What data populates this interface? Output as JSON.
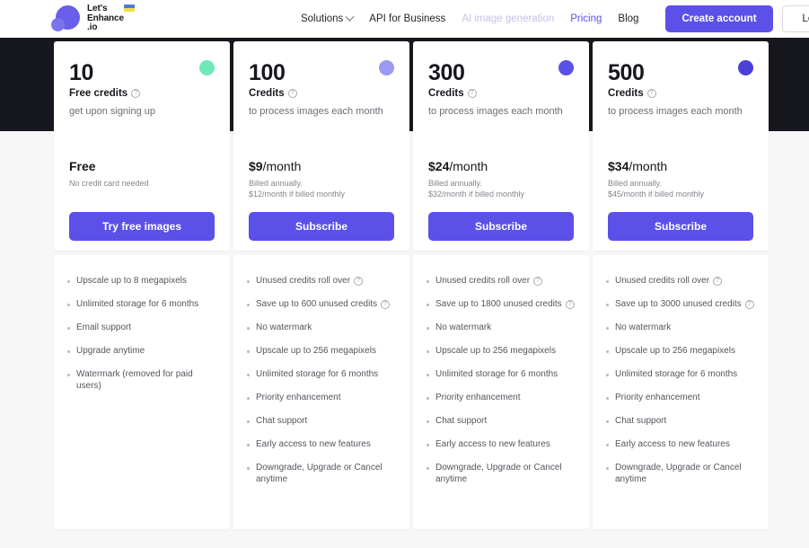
{
  "header": {
    "logo": {
      "line1": "Let's",
      "line2": "Enhance",
      "line3": ".io",
      "flag_name": "ukraine-flag"
    },
    "nav": [
      {
        "label": "Solutions",
        "style": "default",
        "has_chevron": true
      },
      {
        "label": "API for Business",
        "style": "default",
        "has_chevron": false
      },
      {
        "label": "AI image generation",
        "style": "muted",
        "has_chevron": false
      },
      {
        "label": "Pricing",
        "style": "accent",
        "has_chevron": false
      },
      {
        "label": "Blog",
        "style": "default",
        "has_chevron": false
      }
    ],
    "create_account_label": "Create account",
    "login_label": "Login"
  },
  "colors": {
    "accent": "#5b51e8",
    "dark_band": "#17181d",
    "badge_free": "#6fe8b8",
    "badge_100": "#9a9bf0",
    "badge_300": "#5a51e8",
    "badge_500": "#4b3fd6"
  },
  "plans": [
    {
      "credits_number": "10",
      "credits_label": "Free credits",
      "credits_has_info": true,
      "credits_sub": "get upon signing up",
      "badge_color": "#6fe8b8",
      "badge_name": "plan-badge-free",
      "price_main": "Free",
      "price_per": "",
      "price_note_line1": "No credit card needed",
      "price_note_line2": "",
      "cta_label": "Try free images",
      "features": [
        {
          "text": "Upscale up to 8 megapixels",
          "info": false
        },
        {
          "text": "Unlimited storage for 6 months",
          "info": false
        },
        {
          "text": "Email support",
          "info": false
        },
        {
          "text": "Upgrade anytime",
          "info": false
        },
        {
          "text": "Watermark (removed for paid users)",
          "info": false
        }
      ]
    },
    {
      "credits_number": "100",
      "credits_label": "Credits",
      "credits_has_info": true,
      "credits_sub": "to process images each month",
      "badge_color": "#9a9bf0",
      "badge_name": "plan-badge-100",
      "price_main": "$9",
      "price_per": "/month",
      "price_note_line1": "Billed annually.",
      "price_note_line2": "$12/month if billed monthly",
      "cta_label": "Subscribe",
      "features": [
        {
          "text": "Unused credits roll over",
          "info": true
        },
        {
          "text": "Save up to 600 unused credits",
          "info": true
        },
        {
          "text": "No watermark",
          "info": false
        },
        {
          "text": "Upscale up to 256 megapixels",
          "info": false
        },
        {
          "text": "Unlimited storage for 6 months",
          "info": false
        },
        {
          "text": "Priority enhancement",
          "info": false
        },
        {
          "text": "Chat support",
          "info": false
        },
        {
          "text": "Early access to new features",
          "info": false
        },
        {
          "text": "Downgrade, Upgrade or Cancel anytime",
          "info": false
        }
      ]
    },
    {
      "credits_number": "300",
      "credits_label": "Credits",
      "credits_has_info": true,
      "credits_sub": "to process images each month",
      "badge_color": "#5a51e8",
      "badge_name": "plan-badge-300",
      "price_main": "$24",
      "price_per": "/month",
      "price_note_line1": "Billed annually.",
      "price_note_line2": "$32/month if billed monthly",
      "cta_label": "Subscribe",
      "features": [
        {
          "text": "Unused credits roll over",
          "info": true
        },
        {
          "text": "Save up to 1800 unused credits",
          "info": true
        },
        {
          "text": "No watermark",
          "info": false
        },
        {
          "text": "Upscale up to 256 megapixels",
          "info": false
        },
        {
          "text": "Unlimited storage for 6 months",
          "info": false
        },
        {
          "text": "Priority enhancement",
          "info": false
        },
        {
          "text": "Chat support",
          "info": false
        },
        {
          "text": "Early access to new features",
          "info": false
        },
        {
          "text": "Downgrade, Upgrade or Cancel anytime",
          "info": false
        }
      ]
    },
    {
      "credits_number": "500",
      "credits_label": "Credits",
      "credits_has_info": true,
      "credits_sub": "to process images each month",
      "badge_color": "#4b3fd6",
      "badge_name": "plan-badge-500",
      "price_main": "$34",
      "price_per": "/month",
      "price_note_line1": "Billed annually.",
      "price_note_line2": "$45/month if billed monthly",
      "cta_label": "Subscribe",
      "features": [
        {
          "text": "Unused credits roll over",
          "info": true
        },
        {
          "text": "Save up to 3000 unused credits",
          "info": true
        },
        {
          "text": "No watermark",
          "info": false
        },
        {
          "text": "Upscale up to 256 megapixels",
          "info": false
        },
        {
          "text": "Unlimited storage for 6 months",
          "info": false
        },
        {
          "text": "Priority enhancement",
          "info": false
        },
        {
          "text": "Chat support",
          "info": false
        },
        {
          "text": "Early access to new features",
          "info": false
        },
        {
          "text": "Downgrade, Upgrade or Cancel anytime",
          "info": false
        }
      ]
    }
  ]
}
